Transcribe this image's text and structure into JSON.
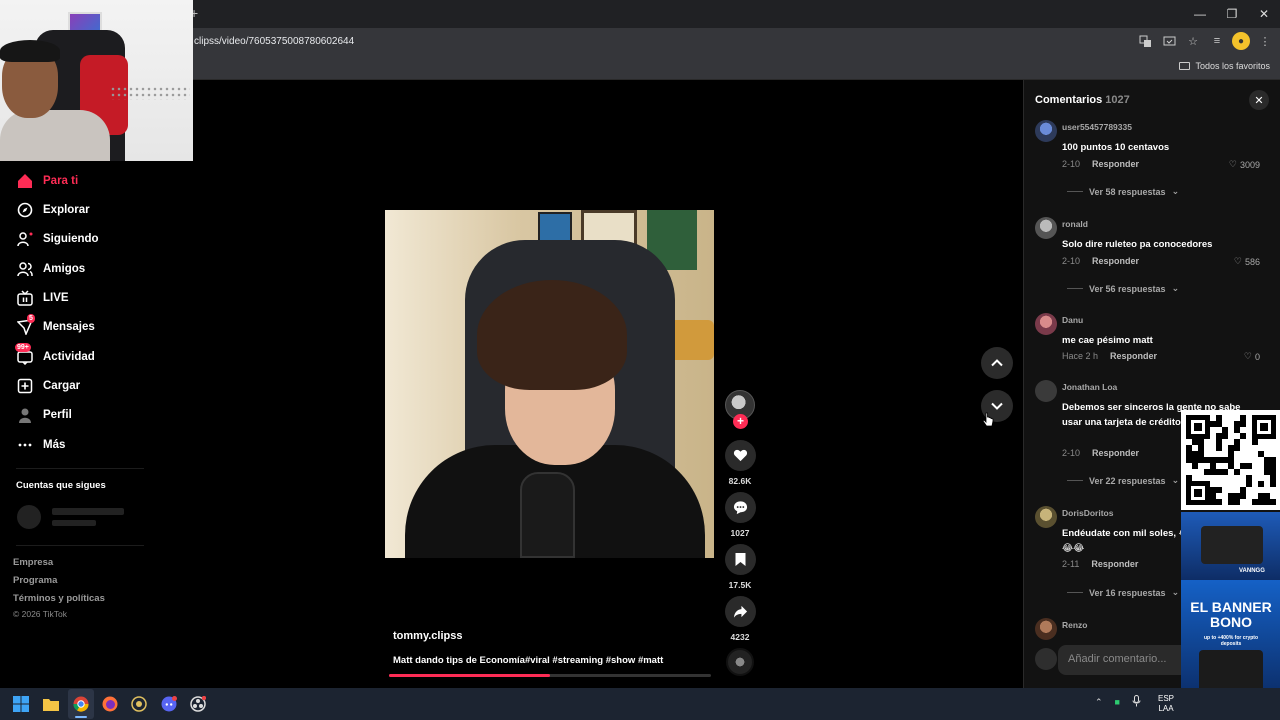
{
  "browser": {
    "tab_new": "+",
    "url": "clipss/video/7605375008780602644",
    "bookmarks_all": "Todos los favoritos",
    "window_controls": [
      "—",
      "❐",
      "✕"
    ]
  },
  "sidebar": {
    "items": [
      {
        "label": "Para ti",
        "icon": "home-icon",
        "active": true
      },
      {
        "label": "Explorar",
        "icon": "compass-icon"
      },
      {
        "label": "Siguiendo",
        "icon": "following-icon"
      },
      {
        "label": "Amigos",
        "icon": "friends-icon"
      },
      {
        "label": "LIVE",
        "icon": "live-icon"
      },
      {
        "label": "Mensajes",
        "icon": "messages-icon",
        "badge": "5"
      },
      {
        "label": "Actividad",
        "icon": "activity-icon",
        "badge": "99+"
      },
      {
        "label": "Cargar",
        "icon": "upload-icon"
      },
      {
        "label": "Perfil",
        "icon": "profile-icon"
      },
      {
        "label": "Más",
        "icon": "more-icon"
      }
    ],
    "following_title": "Cuentas que sigues",
    "footer": [
      "Empresa",
      "Programa",
      "Términos y políticas"
    ],
    "copyright": "© 2026 TikTok"
  },
  "video": {
    "author": "tommy.clipss",
    "caption": "Matt dando tips de Economía#viral #streaming #show #matt",
    "progress": 0.5
  },
  "actions": {
    "likes": "82.6K",
    "comments": "1027",
    "saves": "17.5K",
    "shares": "4232"
  },
  "comments_panel": {
    "title": "Comentarios",
    "count": "1027",
    "close": "✕",
    "items": [
      {
        "user": "user55457789335",
        "text": "100 puntos 10 centavos",
        "date": "2-10",
        "reply": "Responder",
        "likes": "3009",
        "view_replies": "Ver 58 respuestas"
      },
      {
        "user": "ronald",
        "text": "Solo dire ruleteo pa conocedores",
        "date": "2-10",
        "reply": "Responder",
        "likes": "586",
        "view_replies": "Ver 56 respuestas"
      },
      {
        "user": "Danu",
        "text": "me cae pésimo matt",
        "date": "Hace 2 h",
        "reply": "Responder",
        "likes": "0",
        "view_replies": ""
      },
      {
        "user": "Jonathan Loa",
        "text": "Debemos ser sinceros la gente no sabe usar una tarjeta de crédito provecho",
        "date": "2-10",
        "reply": "Responder",
        "likes": "",
        "view_replies": "Ver 22 respuestas"
      },
      {
        "user": "DorisDoritos",
        "text": "Endéudate con mil soles, 😂😂😂",
        "date": "2-11",
        "reply": "Responder",
        "likes": "",
        "view_replies": "Ver 16 respuestas"
      },
      {
        "user": "Renzo",
        "text": "",
        "date": "",
        "reply": "",
        "likes": "",
        "view_replies": ""
      }
    ],
    "add_placeholder": "Añadir comentario..."
  },
  "ad": {
    "brand": "VANNGG",
    "headline": "EL BANNER BONO",
    "sub": "up to +400% for crypto deposits"
  },
  "taskbar": {
    "lang_top": "ESP",
    "lang_bottom": "LAA"
  },
  "colors": {
    "accent": "#fe2c55",
    "panel": "#121212",
    "chrome": "#35363a"
  }
}
